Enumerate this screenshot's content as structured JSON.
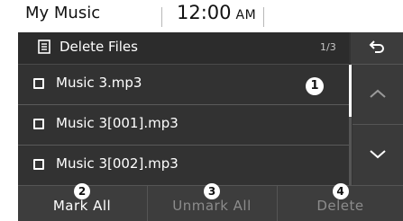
{
  "status_bar": {
    "app_title": "My Music",
    "time": "12:00",
    "ampm": "AM"
  },
  "header": {
    "icon": "document-list-icon",
    "title": "Delete Files",
    "page_indicator": "1/3"
  },
  "back_button": {
    "icon": "back-arrow-icon"
  },
  "file_list": [
    {
      "name": "Music 3.mp3",
      "checked": false
    },
    {
      "name": "Music 3[001].mp3",
      "checked": false
    },
    {
      "name": "Music 3[002].mp3",
      "checked": false
    }
  ],
  "scroll": {
    "up_icon": "chevron-up-icon",
    "down_icon": "chevron-down-icon"
  },
  "actions": {
    "mark_all": "Mark All",
    "unmark_all": "Unmark All",
    "delete": "Delete"
  },
  "callouts": {
    "list": "1",
    "mark_all": "2",
    "unmark_all": "3",
    "delete": "4"
  },
  "colors": {
    "panel": "#323232",
    "text": "#ffffff",
    "disabled_text": "#8c8c8c"
  }
}
